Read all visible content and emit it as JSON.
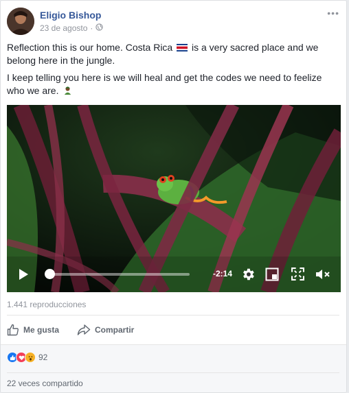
{
  "post": {
    "author": "Eligio Bishop",
    "date": "23 de agosto",
    "separator": "·",
    "more": "•••",
    "text_line1_a": "Reflection this is our home. Costa Rica",
    "text_line1_b": "is a very sacred place and we belong here in the jungle.",
    "text_line2": "I keep telling you here is we will heal and get the codes we need to feelize who we are."
  },
  "video": {
    "time_remaining": "-2:14",
    "progress": 0.02,
    "views": "1.441 reproducciones"
  },
  "actions": {
    "like": "Me gusta",
    "share": "Compartir"
  },
  "footer": {
    "reaction_count": "92",
    "shares": "22 veces compartido"
  },
  "colors": {
    "author": "#365899",
    "meta": "#90949c",
    "like_reaction": "#1877f2",
    "love_reaction": "#f33e58",
    "wow_reaction": "#f7b125"
  }
}
